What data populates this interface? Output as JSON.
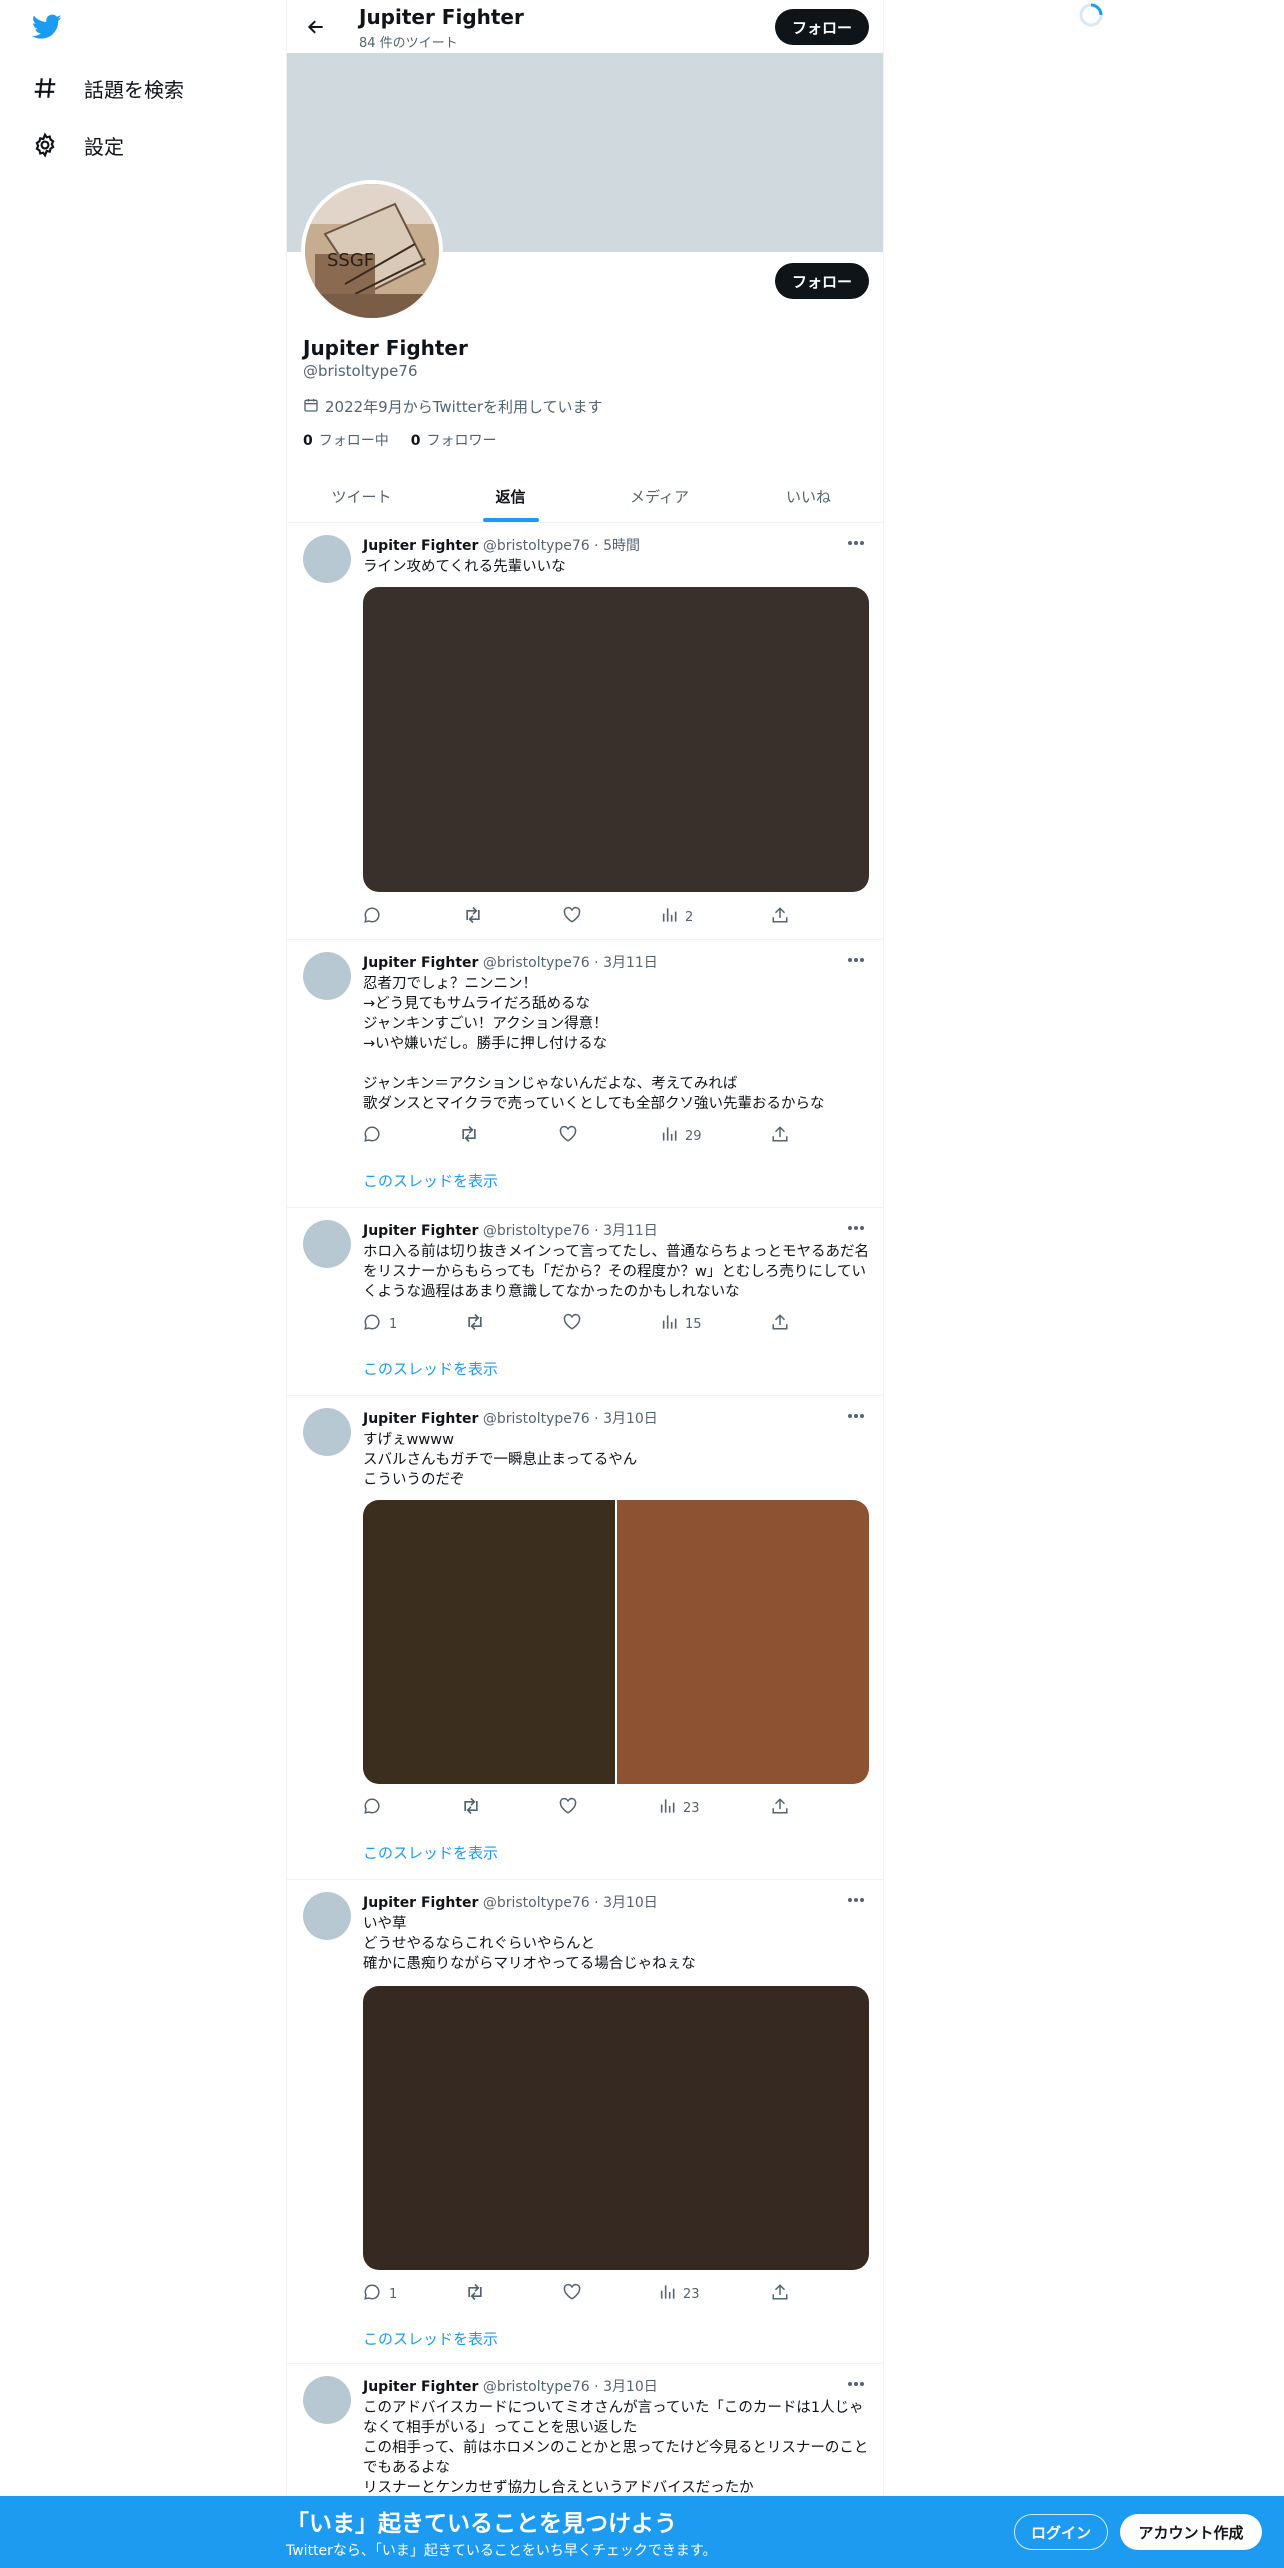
{
  "nav": {
    "logo_icon": "twitter-bird-icon",
    "explore_label": "話題を検索",
    "settings_label": "設定"
  },
  "header": {
    "name": "Jupiter Fighter",
    "tweet_count": "84 件のツイート",
    "follow_label": "フォロー"
  },
  "profile": {
    "name": "Jupiter Fighter",
    "handle": "@bristoltype76",
    "joined": "2022年9月からTwitterを利用しています",
    "following_count": "0",
    "following_label": "フォロー中",
    "followers_count": "0",
    "followers_label": "フォロワー",
    "follow_label": "フォロー"
  },
  "tabs": [
    "ツイート",
    "返信",
    "メディア",
    "いいね"
  ],
  "tweets": [
    {
      "name": "Jupiter Fighter",
      "meta": "@bristoltype76 · 5時間",
      "text": "ライン攻めてくれる先輩いいな",
      "reply_count": "",
      "views": "2",
      "thread_link": ""
    },
    {
      "name": "Jupiter Fighter",
      "meta": "@bristoltype76 · 3月11日",
      "text": "忍者刀でしょ？ニンニン！\n→どう見てもサムライだろ舐めるな\nジャンキンすごい！アクション得意！\n→いや嫌いだし。勝手に押し付けるな\n\nジャンキン＝アクションじゃないんだよな、考えてみれば\n歌ダンスとマイクラで売っていくとしても全部クソ強い先輩おるからな",
      "reply_count": "",
      "views": "29",
      "thread_link": "このスレッドを表示"
    },
    {
      "name": "Jupiter Fighter",
      "meta": "@bristoltype76 · 3月11日",
      "text": "ホロ入る前は切り抜きメインって言ってたし、普通ならちょっとモヤるあだ名をリスナーからもらっても「だから？その程度か？w」とむしろ売りにしていくような過程はあまり意識してなかったのかもしれないな",
      "reply_count": "1",
      "views": "15",
      "thread_link": "このスレッドを表示"
    },
    {
      "name": "Jupiter Fighter",
      "meta": "@bristoltype76 · 3月10日",
      "text": "すげぇwwww\nスバルさんもガチで一瞬息止まってるやん\nこういうのだぞ",
      "reply_count": "",
      "views": "23",
      "thread_link": "このスレッドを表示"
    },
    {
      "name": "Jupiter Fighter",
      "meta": "@bristoltype76 · 3月10日",
      "text": "いや草\nどうせやるならこれぐらいやらんと\n確かに愚痴りながらマリオやってる場合じゃねぇな",
      "reply_count": "1",
      "views": "23",
      "thread_link": "このスレッドを表示"
    },
    {
      "name": "Jupiter Fighter",
      "meta": "@bristoltype76 · 3月10日",
      "text": "このアドバイスカードについてミオさんが言っていた「このカードは1人じゃなくて相手がいる」ってことを思い返した\nこの相手って、前はホロメンのことかと思ってたけど今見るとリスナーのことでもあるよな\nリスナーとケンカせず協力し合えというアドバイスだったか",
      "reply_count": "",
      "views": "",
      "thread_link": ""
    }
  ],
  "media_colors": [
    "#3a302b",
    "#3b2e1e",
    "#8c5232",
    "#362922"
  ],
  "bottom_bar": {
    "title": "「いま」起きていることを見つけよう",
    "subtitle": "Twitterなら、「いま」起きていることをいち早くチェックできます。",
    "login_label": "ログイン",
    "signup_label": "アカウント作成"
  },
  "colors": {
    "accent": "#1d9bf0",
    "banner": "#cfd9de",
    "dark_button": "#0f1419"
  }
}
